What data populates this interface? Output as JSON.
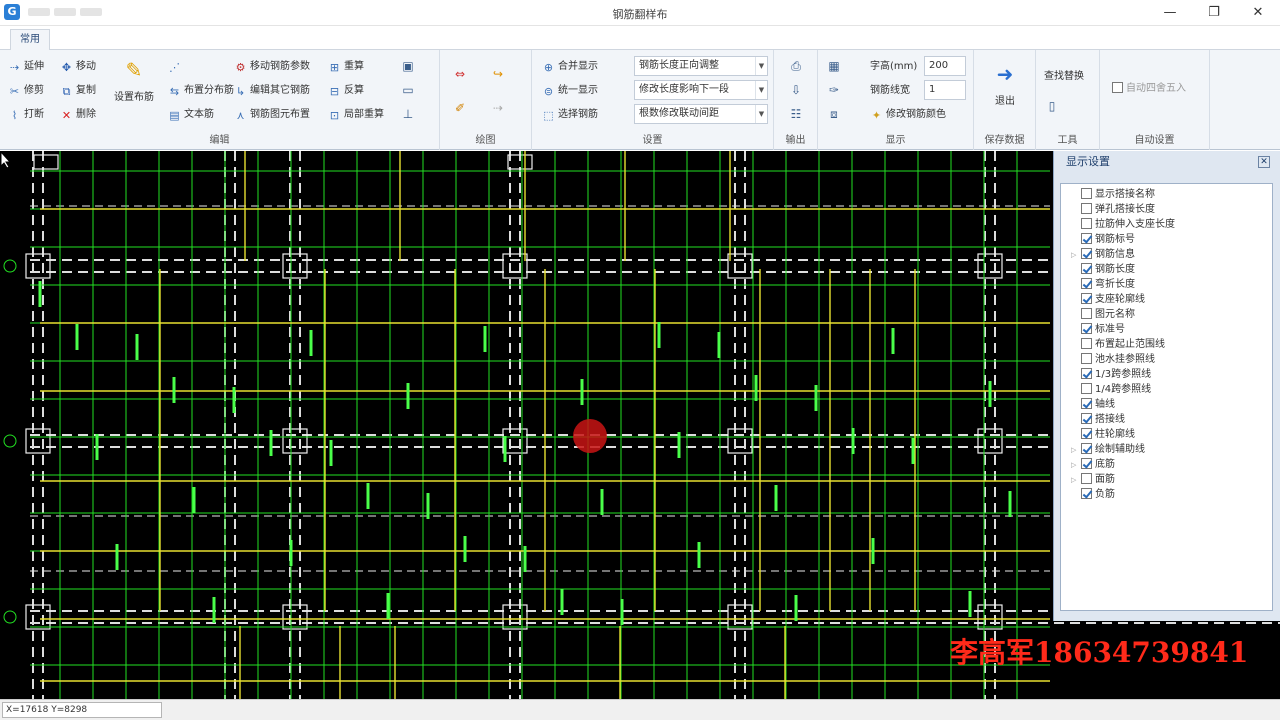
{
  "window": {
    "title": "钢筋翻样布",
    "minimize": "—",
    "maximize": "❐",
    "close": "✕"
  },
  "tabs": [
    {
      "label": "常用"
    }
  ],
  "ribbon": {
    "edit_group": {
      "label": "编辑",
      "extend": "延伸",
      "move": "移动",
      "trim": "修剪",
      "copy": "复制",
      "break": "打断",
      "delete": "删除",
      "set_rebar": "设置布筋",
      "lay_dist_rebar": "布置分布筋",
      "text_rebar": "文本筋",
      "move_rebar_params": "移动钢筋参数",
      "edit_other_rebar": "编辑其它钢筋",
      "rebar_figure_edit": "钢筋图元布置",
      "recalc": "重算",
      "reverse_calc": "反算",
      "partial_recalc": "局部重算"
    },
    "draw_group": {
      "label": "绘图"
    },
    "settings_group": {
      "label": "设置",
      "merge_display": "合并显示",
      "unify_display": "统一显示",
      "select_rebar": "选择钢筋",
      "length_adjust": "钢筋长度正向调整",
      "modify_length": "修改长度影响下一段",
      "modify_spacing": "根数修改联动间距"
    },
    "output_group": {
      "label": "输出"
    },
    "display_group": {
      "label": "显示",
      "font_height_label": "字高(mm)",
      "font_height_value": "200",
      "line_width_label": "钢筋线宽",
      "line_width_value": "1",
      "modify_color": "修改钢筋颜色"
    },
    "save_group": {
      "label": "保存数据",
      "exit": "退出"
    },
    "tools_group": {
      "label": "工具",
      "find_replace": "查找替换"
    },
    "auto_group": {
      "label": "自动设置",
      "auto_round": "自动四舍五入"
    }
  },
  "display_panel": {
    "title": "显示设置",
    "close": "✕",
    "options": [
      {
        "label": "显示搭接名称",
        "checked": false,
        "expandable": false
      },
      {
        "label": "弹孔搭接长度",
        "checked": false,
        "expandable": false
      },
      {
        "label": "拉筋伸入支座长度",
        "checked": false,
        "expandable": false
      },
      {
        "label": "钢筋标号",
        "checked": true,
        "expandable": false
      },
      {
        "label": "钢筋信息",
        "checked": true,
        "expandable": true
      },
      {
        "label": "钢筋长度",
        "checked": true,
        "expandable": false
      },
      {
        "label": "弯折长度",
        "checked": true,
        "expandable": false
      },
      {
        "label": "支座轮廓线",
        "checked": true,
        "expandable": false
      },
      {
        "label": "图元名称",
        "checked": false,
        "expandable": false
      },
      {
        "label": "标准号",
        "checked": true,
        "expandable": false
      },
      {
        "label": "布置起止范围线",
        "checked": false,
        "expandable": false
      },
      {
        "label": "池水挂参照线",
        "checked": false,
        "expandable": false
      },
      {
        "label": "1/3跨参照线",
        "checked": true,
        "expandable": false
      },
      {
        "label": "1/4跨参照线",
        "checked": false,
        "expandable": false
      },
      {
        "label": "轴线",
        "checked": true,
        "expandable": false
      },
      {
        "label": "搭接线",
        "checked": true,
        "expandable": false
      },
      {
        "label": "柱轮廓线",
        "checked": true,
        "expandable": false
      },
      {
        "label": "绘制辅助线",
        "checked": true,
        "expandable": true
      },
      {
        "label": "底筋",
        "checked": true,
        "expandable": true
      },
      {
        "label": "面筋",
        "checked": false,
        "expandable": true
      },
      {
        "label": "负筋",
        "checked": true,
        "expandable": false
      }
    ]
  },
  "canvas": {
    "watermark": "李高军18634739841",
    "bg_color": "#000000",
    "rebar_green": "#22e022",
    "rebar_yellow": "#e8e030"
  },
  "statusbar": {
    "coords": "X=17618 Y=8298"
  }
}
